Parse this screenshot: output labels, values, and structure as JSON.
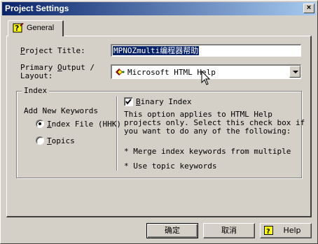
{
  "window": {
    "title": "Project Settings",
    "close_glyph": "×"
  },
  "tabs": [
    {
      "label": "General",
      "icon": "help-question-icon"
    }
  ],
  "fields": {
    "project_title": {
      "label_access": "P",
      "label_rest": "roject Title:",
      "value": "MPNOZmulti编程器帮助"
    },
    "primary_output": {
      "label_line1_pre": "Primary ",
      "label_access": "O",
      "label_line1_post": "utput /",
      "label_line2": "Layout:",
      "value": "Microsoft HTML Help",
      "icon": "html-help-icon"
    }
  },
  "index_group": {
    "title": "Index",
    "add_new_keywords_label": "Add New Keywords",
    "options": [
      {
        "access": "I",
        "rest": "ndex File (HHK)",
        "selected": true
      },
      {
        "access": "T",
        "rest": "opics",
        "selected": false
      }
    ],
    "binary_index": {
      "access": "B",
      "rest": "inary Index",
      "checked": true,
      "desc_line1": "This option applies to HTML Help",
      "desc_line2": "projects only. Select this check box if",
      "desc_line3": "you want to do any of the following:",
      "bullet1": "* Merge index keywords from multiple",
      "bullet2": "* Use topic keywords"
    }
  },
  "buttons": {
    "ok": "确定",
    "cancel": "取消",
    "help": "Help"
  }
}
